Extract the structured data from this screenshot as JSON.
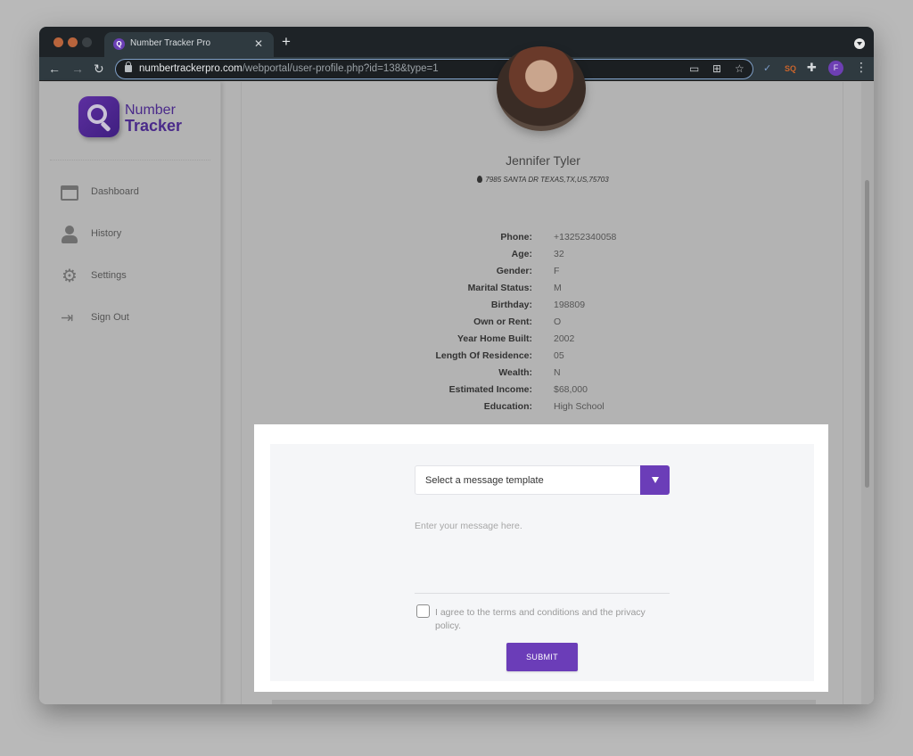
{
  "browser": {
    "tab_title": "Number Tracker Pro",
    "tab_close_icon": "close-icon",
    "new_tab_icon": "plus-icon",
    "url_domain": "numbertrackerpro.com",
    "url_path": "/webportal/user-profile.php?id=138&type=1",
    "profile_initial": "F",
    "extension_icons": [
      "checklist-extension-icon",
      "sq-extension-icon",
      "puzzle-extensions-icon"
    ]
  },
  "sidebar": {
    "logo_line1": "Number",
    "logo_line2": "Tracker",
    "items": [
      {
        "label": "Dashboard",
        "icon": "dashboard-icon"
      },
      {
        "label": "History",
        "icon": "user-icon"
      },
      {
        "label": "Settings",
        "icon": "gear-icon"
      },
      {
        "label": "Sign Out",
        "icon": "sign-out-icon"
      }
    ]
  },
  "profile": {
    "name": "Jennifer Tyler",
    "address": "7985 SANTA DR TEXAS,TX,US,75703",
    "details": [
      {
        "label": "Phone:",
        "value": "+13252340058"
      },
      {
        "label": "Age:",
        "value": "32"
      },
      {
        "label": "Gender:",
        "value": "F"
      },
      {
        "label": "Marital Status:",
        "value": "M"
      },
      {
        "label": "Birthday:",
        "value": "198809"
      },
      {
        "label": "Own or Rent:",
        "value": "O"
      },
      {
        "label": "Year Home Built:",
        "value": "2002"
      },
      {
        "label": "Length Of Residence:",
        "value": "05"
      },
      {
        "label": "Wealth:",
        "value": "N"
      },
      {
        "label": "Estimated Income:",
        "value": "$68,000"
      },
      {
        "label": "Education:",
        "value": "High School"
      }
    ]
  },
  "message_form": {
    "template_select": "Select a message template",
    "message_placeholder": "Enter your message here.",
    "message_value": "",
    "agree_label": "I agree to the terms and conditions and the privacy policy.",
    "agree_checked": false,
    "submit_label": "SUBMIT"
  },
  "colors": {
    "accent": "#6b3db8",
    "browser_chrome": "#2f3a40"
  }
}
